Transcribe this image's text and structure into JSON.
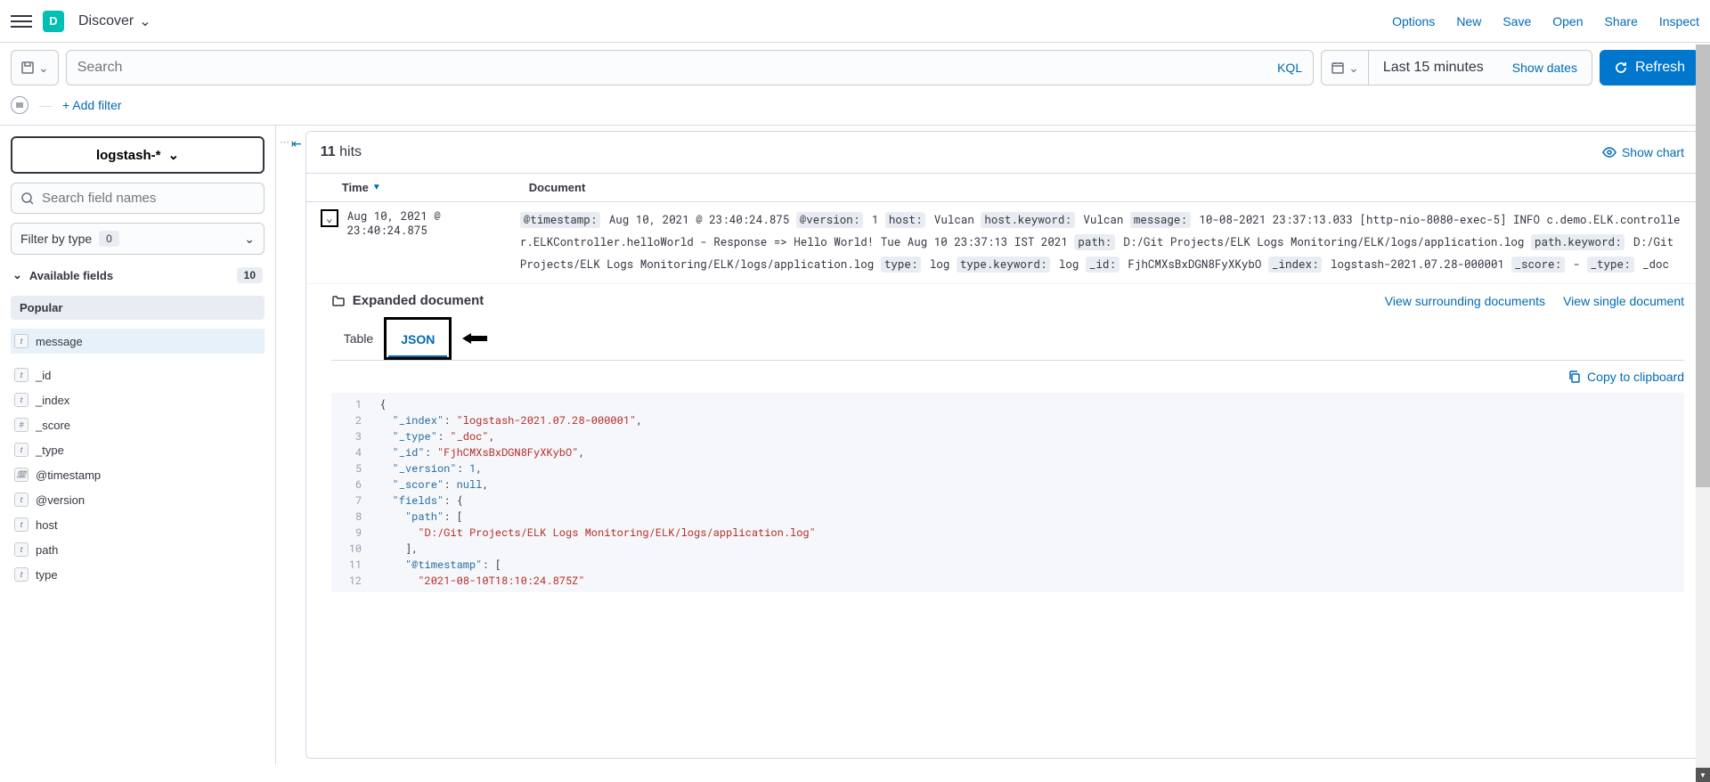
{
  "header": {
    "logo_letter": "D",
    "app_name": "Discover",
    "links": {
      "options": "Options",
      "new": "New",
      "save": "Save",
      "open": "Open",
      "share": "Share",
      "inspect": "Inspect"
    }
  },
  "query": {
    "search_placeholder": "Search",
    "kql_label": "KQL",
    "date_range": "Last 15 minutes",
    "show_dates": "Show dates",
    "refresh": "Refresh",
    "add_filter": "+ Add filter"
  },
  "sidebar": {
    "index_pattern": "logstash-*",
    "field_search_placeholder": "Search field names",
    "filter_by_type_label": "Filter by type",
    "filter_by_type_count": "0",
    "available_fields_label": "Available fields",
    "available_fields_count": "10",
    "popular_label": "Popular",
    "popular_fields": [
      {
        "type": "t",
        "name": "message"
      }
    ],
    "fields": [
      {
        "type": "t",
        "name": "_id"
      },
      {
        "type": "t",
        "name": "_index"
      },
      {
        "type": "#",
        "name": "_score"
      },
      {
        "type": "t",
        "name": "_type"
      },
      {
        "type": "d",
        "name": "@timestamp"
      },
      {
        "type": "t",
        "name": "@version"
      },
      {
        "type": "t",
        "name": "host"
      },
      {
        "type": "t",
        "name": "path"
      },
      {
        "type": "t",
        "name": "type"
      }
    ]
  },
  "results": {
    "hits_number": "11",
    "hits_word": "hits",
    "show_chart": "Show chart",
    "col_time": "Time",
    "col_document": "Document",
    "row_time": "Aug 10, 2021 @ 23:40:24.875",
    "row_fields": [
      {
        "k": "@timestamp:",
        "v": "Aug 10, 2021 @ 23:40:24.875"
      },
      {
        "k": "@version:",
        "v": "1"
      },
      {
        "k": "host:",
        "v": "Vulcan"
      },
      {
        "k": "host.keyword:",
        "v": "Vulcan"
      },
      {
        "k": "message:",
        "v": "10-08-2021 23:37:13.033 [http-nio-8080-exec-5] INFO c.demo.ELK.controller.ELKController.helloWorld - Response => Hello World! Tue Aug 10 23:37:13 IST 2021"
      },
      {
        "k": "path:",
        "v": "D:/Git Projects/ELK Logs Monitoring/ELK/logs/application.log"
      },
      {
        "k": "path.keyword:",
        "v": "D:/Git Projects/ELK Logs Monitoring/ELK/logs/application.log"
      },
      {
        "k": "type:",
        "v": "log"
      },
      {
        "k": "type.keyword:",
        "v": "log"
      },
      {
        "k": "_id:",
        "v": "FjhCMXsBxDGN8FyXKybO"
      },
      {
        "k": "_index:",
        "v": "logstash-2021.07.28-000001"
      },
      {
        "k": "_score:",
        "v": " -"
      },
      {
        "k": "_type:",
        "v": "_doc"
      }
    ]
  },
  "expanded": {
    "title": "Expanded document",
    "view_surrounding": "View surrounding documents",
    "view_single": "View single document",
    "tab_table": "Table",
    "tab_json": "JSON",
    "copy": "Copy to clipboard",
    "json_lines": [
      [
        {
          "t": "punc",
          "v": "{"
        }
      ],
      [
        {
          "t": "pad",
          "v": "  "
        },
        {
          "t": "key",
          "v": "\"_index\""
        },
        {
          "t": "punc",
          "v": ": "
        },
        {
          "t": "str",
          "v": "\"logstash-2021.07.28-000001\""
        },
        {
          "t": "punc",
          "v": ","
        }
      ],
      [
        {
          "t": "pad",
          "v": "  "
        },
        {
          "t": "key",
          "v": "\"_type\""
        },
        {
          "t": "punc",
          "v": ": "
        },
        {
          "t": "str",
          "v": "\"_doc\""
        },
        {
          "t": "punc",
          "v": ","
        }
      ],
      [
        {
          "t": "pad",
          "v": "  "
        },
        {
          "t": "key",
          "v": "\"_id\""
        },
        {
          "t": "punc",
          "v": ": "
        },
        {
          "t": "str",
          "v": "\"FjhCMXsBxDGN8FyXKybO\""
        },
        {
          "t": "punc",
          "v": ","
        }
      ],
      [
        {
          "t": "pad",
          "v": "  "
        },
        {
          "t": "key",
          "v": "\"_version\""
        },
        {
          "t": "punc",
          "v": ": "
        },
        {
          "t": "num",
          "v": "1"
        },
        {
          "t": "punc",
          "v": ","
        }
      ],
      [
        {
          "t": "pad",
          "v": "  "
        },
        {
          "t": "key",
          "v": "\"_score\""
        },
        {
          "t": "punc",
          "v": ": "
        },
        {
          "t": "null",
          "v": "null"
        },
        {
          "t": "punc",
          "v": ","
        }
      ],
      [
        {
          "t": "pad",
          "v": "  "
        },
        {
          "t": "key",
          "v": "\"fields\""
        },
        {
          "t": "punc",
          "v": ": {"
        }
      ],
      [
        {
          "t": "pad",
          "v": "    "
        },
        {
          "t": "key",
          "v": "\"path\""
        },
        {
          "t": "punc",
          "v": ": ["
        }
      ],
      [
        {
          "t": "pad",
          "v": "      "
        },
        {
          "t": "str",
          "v": "\"D:/Git Projects/ELK Logs Monitoring/ELK/logs/application.log\""
        }
      ],
      [
        {
          "t": "pad",
          "v": "    "
        },
        {
          "t": "punc",
          "v": "],"
        }
      ],
      [
        {
          "t": "pad",
          "v": "    "
        },
        {
          "t": "key",
          "v": "\"@timestamp\""
        },
        {
          "t": "punc",
          "v": ": ["
        }
      ],
      [
        {
          "t": "pad",
          "v": "      "
        },
        {
          "t": "str",
          "v": "\"2021-08-10T18:10:24.875Z\""
        }
      ]
    ]
  }
}
